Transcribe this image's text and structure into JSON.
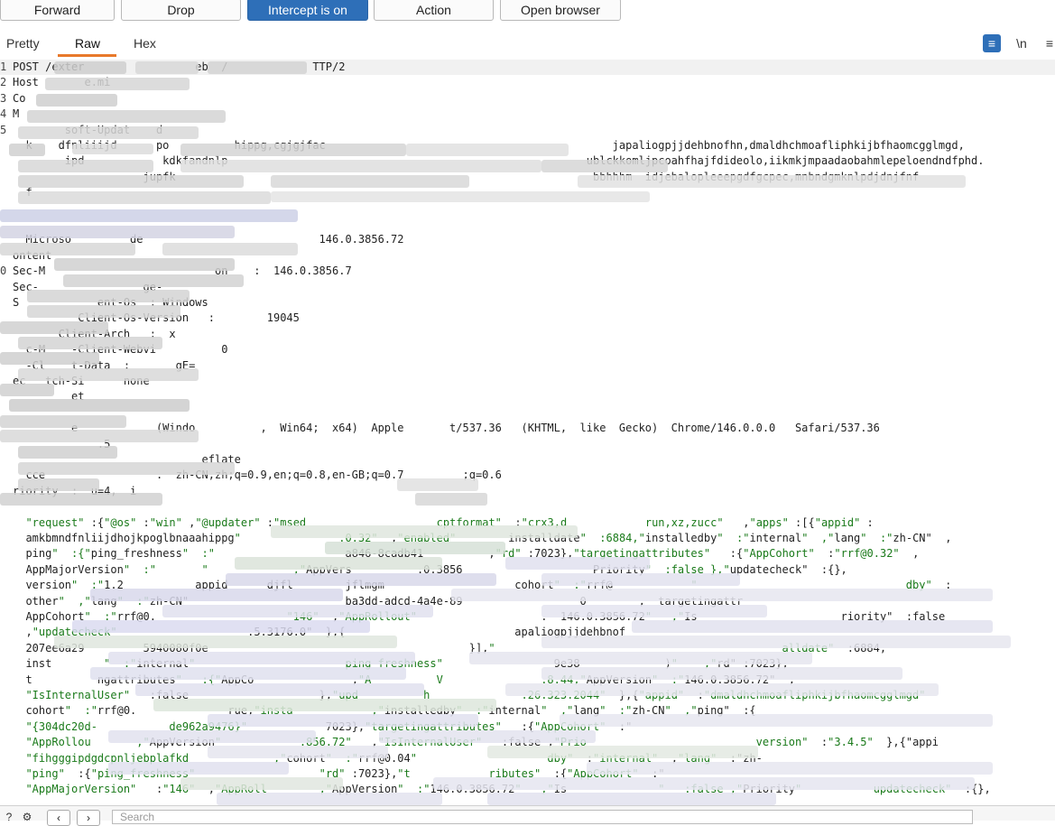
{
  "toolbar": {
    "forward": "Forward",
    "drop": "Drop",
    "intercept": "Intercept is on",
    "action": "Action",
    "open_browser": "Open browser"
  },
  "tabs": {
    "pretty": "Pretty",
    "raw": "Raw",
    "hex": "Hex"
  },
  "tab_icons": {
    "wrap": "≡",
    "newline": "\\n",
    "menu": "≡"
  },
  "line_numbers": [
    "1",
    "2",
    "3",
    "4",
    "5",
    "",
    "",
    "",
    "",
    "",
    "",
    "",
    "",
    "0",
    "",
    "",
    "",
    "",
    "",
    "",
    "",
    "",
    "",
    "",
    "",
    "",
    "",
    "",
    "",
    "",
    ""
  ],
  "header_lines": [
    "POST /exter                 eb  /             TTP/2",
    "Host       e.mi        ",
    "Co        ",
    "M        ",
    "        soft-Updat    d",
    "  k    dfnliiijd      po          hippg,cgjgjfac                                            japaliogpjjdehbnofhn,dmaldhchmoafliphkijbfhaomcgglmgd,",
    "        ipd            kdkfandnlp                                                       ublckkomljpcoahfhajfdideolo,iikmkjmpaadaobahmlepeloendndfphd.",
    "                    jupfk                                                                bbhhhm  idjebalopleeepgdfgcpec,mnbndgmknlpdjdnjfnf",
    "  f   ",
    "",
    "",
    "  Microso         de                           146.0.3856.72",
    "ontent",
    "Sec-M                          on    :  146.0.3856.7",
    "Sec-                ge-",
    "S            ent-Os  : Windows",
    "          Client-Os-Version   :        19045",
    "       Client-Arch   :  x",
    "  c-M    -Client-Webvi          0",
    "  -Cl    t-Data  :       gE=",
    "ec   tch-Si      none",
    "         et    ",
    "",
    "         e            (Windo          ,  Win64;  x64)  Apple       t/537.36   (KHTML,  like  Gecko)  Chrome/146.0.0.0   Safari/537.36",
    "             .5",
    "                             eflate",
    "  cce                 .  zh-CN,zh;q=0.9,en;q=0.8,en-GB;q=0.7         ;q=0.6",
    "riority  :  u=4,  i",
    ""
  ],
  "body_lines": [
    "  \"request\" :{\"@os\" :\"win\" ,\"@updater\" :\"msed                    cptformat\"  :\"crx3,d            run,xz,zucc\"   ,\"apps\" :[{\"appid\" :",
    "  amkbmndfnliijdhojkpoglbnaaahippg\"               .0.32\"  ,\"enabled\"        installdate\"  :6884,\"installedby\"  :\"internal\"  ,\"lang\"  :\"zh-CN\"  ,",
    "  ping\"  :{\"ping_freshness\"  :\"                    a846-8cadb41          ,\"rd\" :7023},\"targetingattributes\"   :{\"AppCohort\"  :\"rrf@0.32\"  ,",
    "  AppMajorVersion\"  :\"       \"             ,\"AppVers          .0.3856                    Priority\"  :false },\"updatecheck\"  :{},",
    "  version\"  :\"1.2           appid      djfl        jflmgm                    cohort\"  :\"rrf@            \"                                dby\"  :",
    "  other\"  ,\"lang\"  :\"zh-CN\"                        ba3dd-adcd-4a4e-89                  0        ,  targetingattr",
    "  AppCohort\"  :\"rrf@0.                    \"146\"  ,\"AppRollout\"                   .  146.0.3856.72\"   ,\"Is                      riority\"  :false",
    "  ,\"updatecheck\"                    .5.3176.0\"  },{                          apaliogpjjdehbnof",
    "  207ee6a29         5940080f0e                                        }],\"                                            alldate\"  :6884,",
    "  inst        \"  :\"internal\"                       ping freshness\"                 9e38             )\"    ,\"rd\" :7023},",
    "  t          ngattributes\"   :{\"AppCo               ,\"A          V               .8.44,\"AppVersion\"  :\"146.0.3856.72\"  ,",
    "  \"IsInternalUser\"   :false                    },\"upd          h              .26.323.2044\"  },{\"appid\"  :\"dmaldhchmoafliphkijbfhaomcgglmgd\"",
    "  cohort\"  :\"rrf@0.              rue,\"insta            ,\"installedby\"  :\"internal\"  ,\"lang\"  :\"zh-CN\"  ,\"ping\"  :{",
    "  \"{304dc20d-           de962a9476}\"            7023},\"targetingattributes\"   :{\"AppCohort\"  :\"",
    "  \"AppRollou       ,\"AppVersion\"            .856.72\"   ,\"IsInternalUser\"   :false ,\"Prio                          version\"  :\"3.4.5\"  },{\"appi",
    "  \"fihgggipdgdcpnljebplafkd             ,\"cohort\"  :\"rrf@0.04\"                    dby\"  :\"internal\"  ,\"lang\"  :\"zh-",
    "  \"ping\"  :{\"ping_freshness\"                   \"rd\" :7023},\"t            ributes\"  :{\"AppCohort\"  :\"",
    "  \"AppMajorVersion\"   :\"146\"  ,\"AppRoll        ,\"AppVersion\"  :\"146.0.3856.72\"   ,\"Is              \"   :false ,\"Priority\"           updatecheck\"  :{},"
  ],
  "bottom": {
    "search_placeholder": "Search"
  },
  "colors": {
    "accent": "#2e6fb8",
    "tab_underline": "#e8792b",
    "string": "#1a7a1a"
  }
}
